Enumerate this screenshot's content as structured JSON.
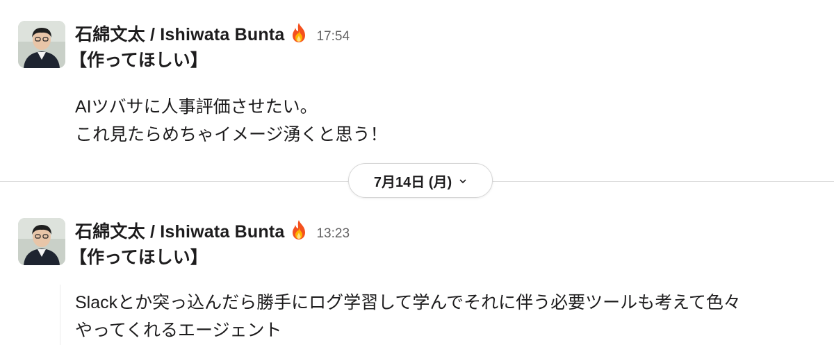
{
  "messages": [
    {
      "author": "石綿文太 / Ishiwata Bunta",
      "status_emoji": "fire-icon",
      "time": "17:54",
      "title": "【作ってほしい】",
      "lines": [
        "AIツバサに人事評価させたい。",
        "これ見たらめちゃイメージ湧くと思う！"
      ]
    },
    {
      "author": "石綿文太 / Ishiwata Bunta",
      "status_emoji": "fire-icon",
      "time": "13:23",
      "title": "【作ってほしい】",
      "lines": [
        "Slackとか突っ込んだら勝手にログ学習して学んでそれに伴う必要ツールも考えて色々",
        "やってくれるエージェント"
      ]
    }
  ],
  "date_divider": {
    "label": "7月14日 (月)",
    "icon": "chevron-down-icon"
  },
  "colors": {
    "text": "#1d1c1d",
    "timestamp": "#616061",
    "divider": "#dddddd"
  }
}
